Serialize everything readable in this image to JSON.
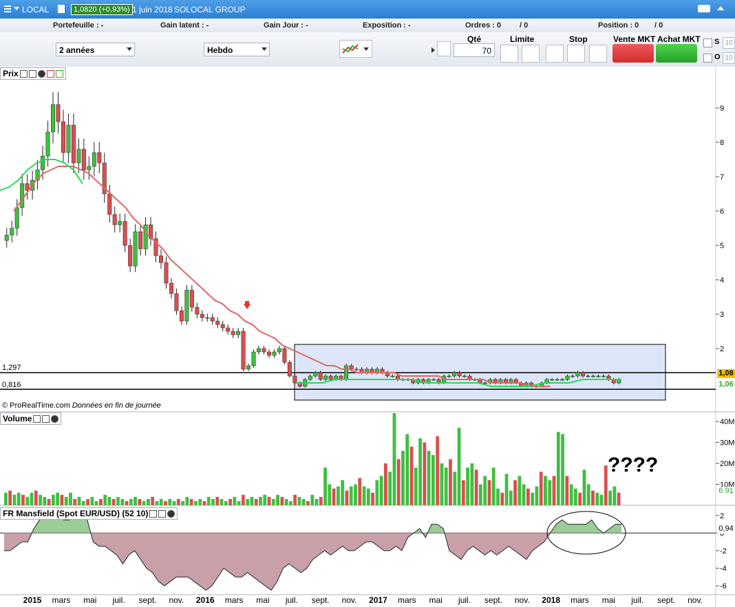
{
  "window": {
    "instrument_code": "LOCAL",
    "price": "1,0820 (+0,93%)",
    "date": "1 juin 2018",
    "name": "SOLOCAL GROUP"
  },
  "info": {
    "portefeuille": "Portefeuille : -",
    "gain_latent": "Gain latent : -",
    "gain_jour": "Gain Jour : -",
    "exposition": "Exposition : -",
    "ordres": "Ordres : 0",
    "ordres_b": "/ 0",
    "position": "Position : 0",
    "position_b": "/ 0"
  },
  "toolbar": {
    "period": "2 années",
    "interval": "Hebdo",
    "qte_label": "Qté",
    "qte_value": "70",
    "limite_label": "Limite",
    "stop_label": "Stop",
    "vente_label": "Vente MKT",
    "achat_label": "Achat MKT",
    "s_label": "S",
    "o_label": "O",
    "s_val": "10",
    "o_val": "10"
  },
  "panels": {
    "price_title": "Prix",
    "volume_title": "Volume",
    "mansfield_title": "FR Mansfield (Spot EUR/USD) (52 10)",
    "copyright": "© ProRealTime.com",
    "copyright_note": "Données en fin de journée",
    "level_high": "1,297",
    "level_low": "0,816",
    "badge_top": "1,08",
    "badge_bottom": "1,06",
    "volume_badge": "6 91",
    "mansfield_badge": "0,94",
    "annotation": "????"
  },
  "colors": {
    "up": "#3fbf3f",
    "down": "#d94f4f",
    "ma_long": "#e06666",
    "ma_short": "#22dd55",
    "box_fill": "#dde6f8",
    "mansfield_pos": "#9ccc98",
    "mansfield_neg": "#c9a0a8",
    "accent": "#2d7ed6"
  },
  "chart_data": [
    {
      "type": "candlestick",
      "title": "Prix",
      "x_ticks": [
        "2015",
        "mars",
        "mai",
        "juil.",
        "sept.",
        "nov.",
        "2016",
        "mars",
        "mai",
        "juil.",
        "sept.",
        "nov.",
        "2017",
        "mars",
        "mai",
        "juil.",
        "sept.",
        "nov.",
        "2018",
        "mars",
        "mai",
        "juil.",
        "sept.",
        "nov."
      ],
      "y_ticks": [
        2,
        3,
        4,
        5,
        6,
        7,
        8,
        9
      ],
      "ylim": [
        0.6,
        9.8
      ],
      "levels": [
        1.297,
        0.816
      ],
      "closes": [
        5.3,
        5.5,
        6.1,
        6.8,
        6.6,
        6.9,
        7.2,
        7.6,
        8.3,
        9.1,
        8.6,
        7.7,
        8.5,
        7.4,
        7.8,
        7.2,
        7.3,
        7.7,
        7.4,
        6.5,
        5.9,
        5.6,
        5.7,
        5.0,
        4.4,
        5.4,
        4.9,
        5.6,
        5.2,
        4.7,
        4.5,
        3.9,
        3.6,
        3.1,
        2.8,
        3.7,
        3.2,
        3.0,
        2.9,
        2.9,
        2.8,
        2.7,
        2.6,
        2.5,
        2.4,
        2.5,
        1.4,
        1.5,
        1.9,
        2.0,
        1.9,
        1.8,
        1.9,
        2.0,
        1.6,
        1.2,
        1.0,
        0.9,
        1.1,
        1.2,
        1.3,
        1.1,
        1.2,
        1.1,
        1.2,
        1.1,
        1.5,
        1.4,
        1.4,
        1.3,
        1.4,
        1.3,
        1.4,
        1.3,
        1.2,
        1.2,
        1.1,
        1.1,
        1.1,
        1.0,
        1.1,
        1.0,
        1.1,
        1.1,
        1.0,
        1.2,
        1.2,
        1.3,
        1.2,
        1.2,
        1.1,
        1.1,
        1.0,
        1.0,
        1.1,
        1.0,
        1.1,
        1.0,
        1.1,
        1.0,
        0.9,
        1.0,
        0.9,
        0.9,
        1.0,
        1.1,
        1.1,
        1.1,
        1.1,
        1.2,
        1.2,
        1.3,
        1.2,
        1.2,
        1.2,
        1.2,
        1.2,
        1.1,
        1.0,
        1.1
      ],
      "ma_long": [
        6.0,
        6.3,
        6.6,
        6.9,
        7.1,
        7.2,
        7.3,
        7.3,
        7.3,
        7.2,
        7.1,
        6.9,
        6.7,
        6.5,
        6.3,
        6.1,
        5.8,
        5.6,
        5.3,
        5.1,
        4.9,
        4.6,
        4.4,
        4.2,
        4.0,
        3.8,
        3.6,
        3.4,
        3.3,
        3.1,
        3.0,
        2.8,
        2.7,
        2.5,
        2.4,
        2.3,
        2.1,
        2.0,
        1.9,
        1.8,
        1.7,
        1.6,
        1.5,
        1.5,
        1.4,
        1.4,
        1.3,
        1.3,
        1.3,
        1.3,
        1.3,
        1.3,
        1.2,
        1.2,
        1.2,
        1.2,
        1.2,
        1.2,
        1.1,
        1.1,
        1.1,
        1.1,
        1.1,
        1.1,
        1.0,
        1.0,
        1.0,
        1.0,
        1.0,
        0.9,
        0.9,
        0.9,
        0.9
      ],
      "ma_short": [
        6.6,
        6.7,
        6.9,
        7.2,
        7.4,
        7.5,
        7.5,
        7.4,
        7.2,
        6.8
      ],
      "recent_ma_short": [
        1.0,
        1.0,
        1.0,
        1.1,
        1.1,
        1.1,
        1.1,
        1.1,
        1.1,
        1.1,
        1.0,
        1.0,
        1.0,
        1.0,
        1.0,
        0.9,
        0.9,
        0.9,
        0.9,
        1.0,
        1.0,
        1.0,
        1.1,
        1.1,
        1.1,
        1.1
      ]
    },
    {
      "type": "bar",
      "title": "Volume",
      "y_ticks": [
        "10M",
        "20M",
        "30M",
        "40M"
      ],
      "ylim": [
        0,
        44
      ],
      "values": [
        6,
        7,
        5,
        6,
        5,
        4,
        6,
        7,
        5,
        4,
        3,
        5,
        6,
        5,
        4,
        6,
        3,
        4,
        2,
        3,
        4,
        2,
        3,
        5,
        4,
        3,
        4,
        3,
        2,
        3,
        4,
        3,
        2,
        3,
        4,
        2,
        3,
        2,
        3,
        2,
        3,
        2,
        4,
        3,
        2,
        3,
        2,
        4,
        3,
        4,
        3,
        2,
        3,
        4,
        2,
        5,
        3,
        4,
        3,
        4,
        5,
        4,
        3,
        5,
        4,
        3,
        2,
        5,
        4,
        3,
        2,
        5,
        3,
        4,
        18,
        10,
        8,
        9,
        12,
        7,
        9,
        10,
        13,
        9,
        8,
        6,
        12,
        14,
        20,
        16,
        44,
        22,
        26,
        34,
        28,
        18,
        32,
        30,
        26,
        24,
        33,
        20,
        18,
        22,
        16,
        37,
        12,
        18,
        20,
        17,
        10,
        14,
        12,
        18,
        8,
        6,
        15,
        7,
        12,
        14,
        10,
        8,
        6,
        9,
        16,
        14,
        12,
        14,
        35,
        34,
        14,
        10,
        8,
        6,
        17,
        10,
        7,
        6,
        5,
        19,
        7,
        9,
        6
      ],
      "last_value_label": "6 91"
    },
    {
      "type": "area",
      "title": "FR Mansfield (Spot EUR/USD) (52 10)",
      "y_ticks": [
        2,
        0,
        -2,
        -4,
        -6
      ],
      "ylim": [
        -7,
        3
      ],
      "values": [
        -2,
        -2,
        -1.5,
        -1,
        -1,
        0.5,
        1.5,
        2.5,
        2.5,
        2,
        1.5,
        1.5,
        2,
        2.5,
        1.5,
        -1,
        -1.5,
        -1.5,
        -2,
        -2.5,
        -3.5,
        -2.5,
        -2,
        -3,
        -4,
        -4.5,
        -5.5,
        -6,
        -5.5,
        -5,
        -5,
        -5,
        -5.5,
        -6,
        -6.5,
        -6,
        -5,
        -4,
        -4.5,
        -5,
        -5,
        -4.5,
        -5,
        -5.5,
        -6,
        -6.5,
        -5.5,
        -4,
        -3.5,
        -4,
        -4.5,
        -4,
        -3,
        -2.5,
        -2,
        -2.5,
        -2,
        -1.5,
        -2,
        -2,
        -1.5,
        -1,
        -1,
        -1.5,
        -2,
        -2,
        -1.5,
        -2,
        -0.5,
        0,
        0.5,
        -0.5,
        1,
        1,
        0.5,
        -2,
        -2.5,
        -3,
        -2,
        -1.5,
        -2,
        -2.5,
        -2,
        -2.5,
        -2,
        -1.5,
        -2,
        -2.5,
        -3,
        -2,
        -1.5,
        -1,
        0,
        1,
        1.5,
        1,
        1,
        1,
        1,
        1.5,
        0.5,
        0,
        0.5,
        1,
        1
      ]
    }
  ]
}
